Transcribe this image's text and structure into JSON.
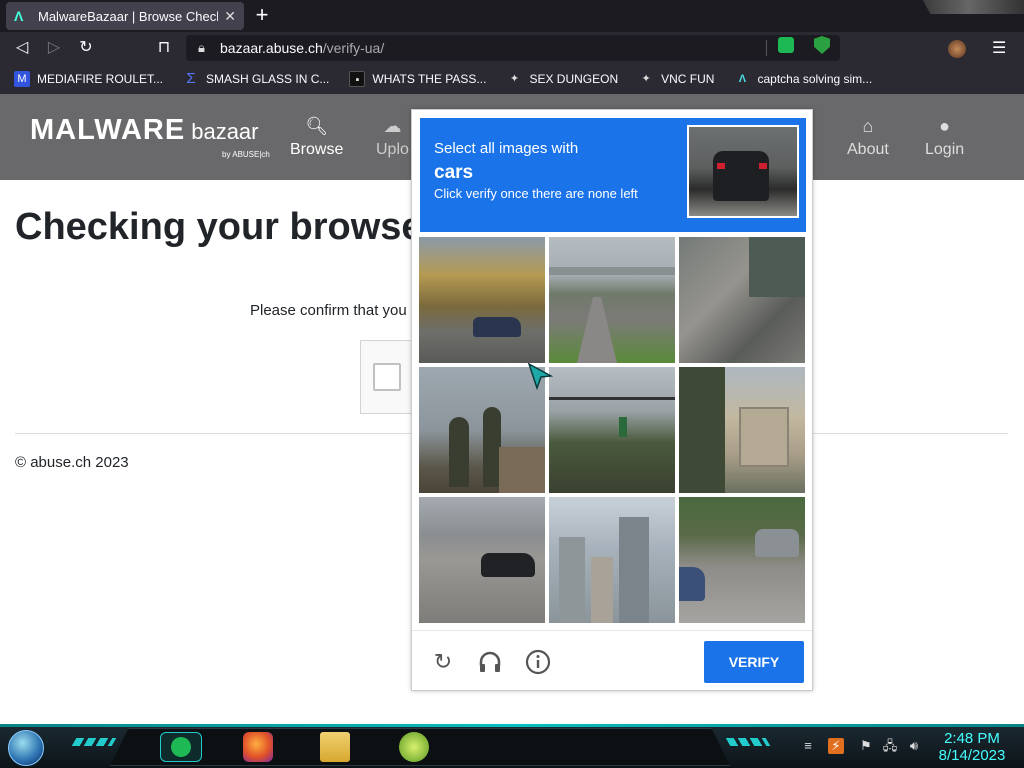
{
  "browser": {
    "tab_title": "MalwareBazaar | Browse Checking",
    "url_host": "bazaar.abuse.ch",
    "url_path": "/verify-ua/",
    "bookmarks": [
      {
        "label": "MEDIAFIRE ROULET...",
        "icon": "mediafire-icon",
        "color": "#3355dd"
      },
      {
        "label": "SMASH GLASS IN C...",
        "icon": "sigma-icon",
        "color": "#3a55e0"
      },
      {
        "label": "WHATS THE PASS...",
        "icon": "lock-site-icon",
        "color": "#222222"
      },
      {
        "label": "SEX DUNGEON",
        "icon": "gear-site-icon",
        "color": "#dddddd"
      },
      {
        "label": "VNC FUN",
        "icon": "gear-site-icon",
        "color": "#dddddd"
      },
      {
        "label": "captcha solving sim...",
        "icon": "a-logo-icon",
        "color": "#4fdde0"
      }
    ]
  },
  "site": {
    "logo_main": "MALWARE",
    "logo_sub": "bazaar",
    "logo_by": "by ABUSE|ch",
    "nav": [
      {
        "label": "Browse",
        "icon": "search-icon"
      },
      {
        "label": "Uplo",
        "icon": "upload-icon"
      },
      {
        "label": "About",
        "icon": "building-icon"
      },
      {
        "label": "Login",
        "icon": "user-icon"
      }
    ],
    "heading": "Checking your browse",
    "confirm_text": "Please confirm that you",
    "footer": "© abuse.ch 2023"
  },
  "captcha": {
    "line1": "Select all images with",
    "target": "cars",
    "line3": "Click verify once there are none left",
    "verify_label": "VERIFY",
    "footer_icons": [
      "refresh-icon",
      "headphones-icon",
      "info-icon"
    ]
  },
  "taskbar": {
    "time": "2:48 PM",
    "date": "8/14/2023"
  }
}
